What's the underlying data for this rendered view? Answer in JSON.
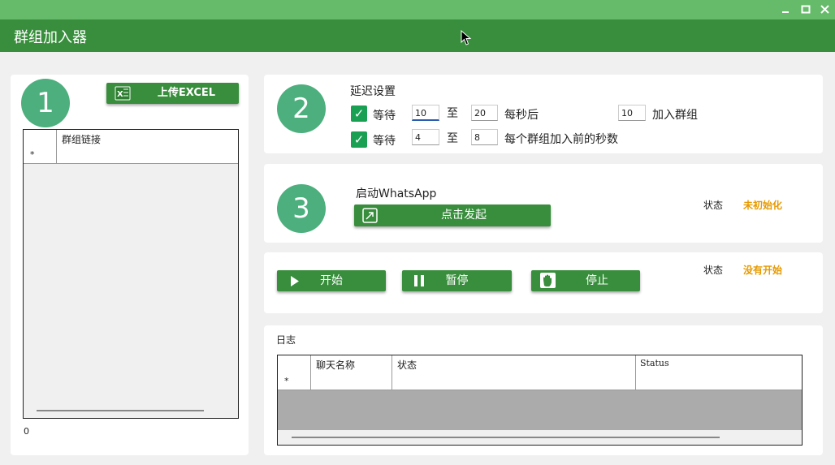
{
  "window": {
    "minimize_icon": "minimize-icon",
    "maximize_icon": "maximize-icon",
    "close_icon": "close-icon"
  },
  "app": {
    "title": "群组加入器"
  },
  "step1": {
    "number": "1",
    "upload_label": "上传EXCEL",
    "grid_header": "群组链接",
    "new_row_marker": "*",
    "count": "0"
  },
  "step2": {
    "number": "2",
    "title": "延迟设置",
    "row1": {
      "wait_label": "等待",
      "from": "10",
      "to_label": "至",
      "to": "20",
      "unit": "每秒后",
      "group_count": "10",
      "suffix": "加入群组"
    },
    "row2": {
      "wait_label": "等待",
      "from": "4",
      "to_label": "至",
      "to": "8",
      "unit": "每个群组加入前的秒数"
    }
  },
  "step3": {
    "number": "3",
    "title": "启动WhatsApp",
    "launch_label": "点击发起",
    "status_label": "状态",
    "status_value": "未初始化"
  },
  "controls": {
    "start_label": "开始",
    "pause_label": "暂停",
    "stop_label": "停止",
    "status_label": "状态",
    "status_value": "没有开始"
  },
  "log": {
    "title": "日志",
    "columns": [
      "聊天名称",
      "状态",
      "Status"
    ],
    "new_row_marker": "*"
  },
  "colors": {
    "title_bar": "#66bb6a",
    "app_bar": "#388e3c",
    "button": "#388e3c",
    "step_circle": "#4caf7d",
    "status": "#e69a00"
  }
}
